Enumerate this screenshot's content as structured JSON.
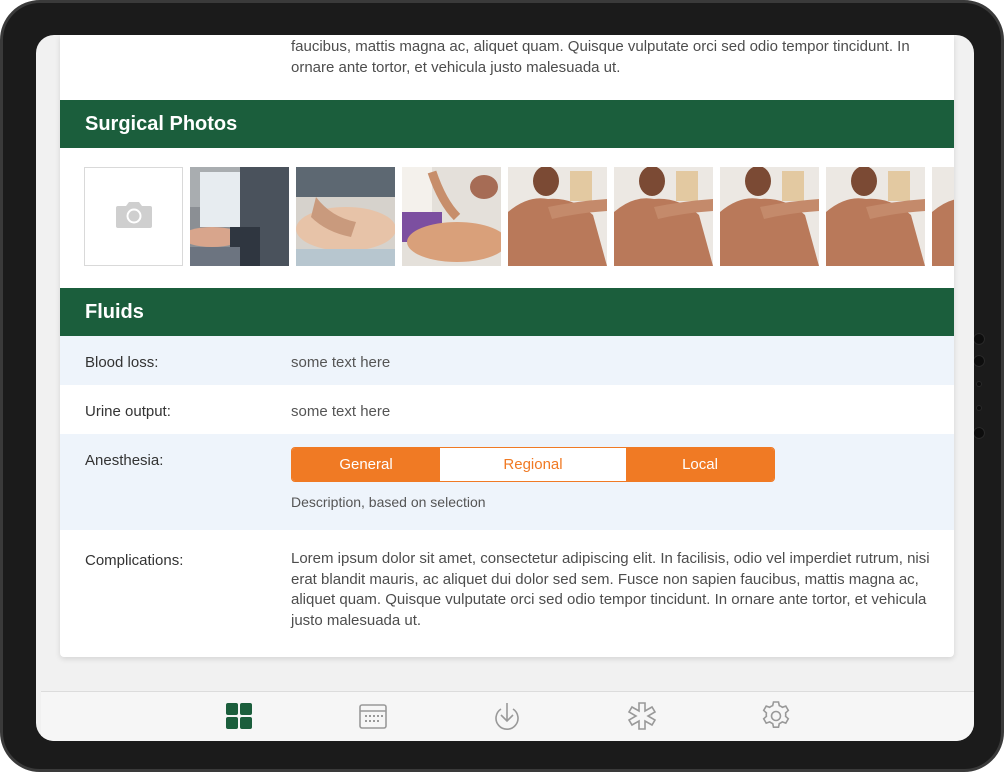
{
  "top_paragraph": "faucibus, mattis magna ac, aliquet quam. Quisque vulputate orci sed odio tempor tincidunt. In ornare ante tortor, et vehicula justo malesuada ut.",
  "photos": {
    "title": "Surgical Photos",
    "add_icon": "camera-icon",
    "thumbnails": [
      {
        "name": "photo-nurse"
      },
      {
        "name": "photo-massage"
      },
      {
        "name": "photo-treatment"
      },
      {
        "name": "photo-shoulder-1"
      },
      {
        "name": "photo-shoulder-2"
      },
      {
        "name": "photo-shoulder-3"
      },
      {
        "name": "photo-shoulder-4"
      },
      {
        "name": "photo-shoulder-5"
      }
    ]
  },
  "fluids": {
    "title": "Fluids",
    "blood_loss": {
      "label": "Blood loss:",
      "value": "some text here"
    },
    "urine_output": {
      "label": "Urine output:",
      "value": "some text here"
    },
    "anesthesia": {
      "label": "Anesthesia:",
      "options": [
        "General",
        "Regional",
        "Local"
      ],
      "selected": "Regional",
      "description": "Description, based on selection"
    },
    "complications": {
      "label": "Complications:",
      "text": "Lorem ipsum dolor sit amet, consectetur adipiscing elit. In facilisis, odio vel imperdiet rutrum, nisi erat blandit mauris, ac aliquet dui dolor sed sem. Fusce non sapien faucibus, mattis magna ac, aliquet quam. Quisque vulputate orci sed odio tempor tincidunt. In ornare ante tortor, et vehicula justo malesuada ut."
    }
  },
  "tabbar": {
    "items": [
      {
        "icon": "grid-icon",
        "active": true
      },
      {
        "icon": "calendar-icon",
        "active": false
      },
      {
        "icon": "download-icon",
        "active": false
      },
      {
        "icon": "asterisk-icon",
        "active": false
      },
      {
        "icon": "gear-icon",
        "active": false
      }
    ]
  },
  "colors": {
    "header_green": "#1b5e3c",
    "accent_orange": "#f07a24",
    "row_alt": "#eef4fb",
    "tab_inactive": "#999999"
  }
}
